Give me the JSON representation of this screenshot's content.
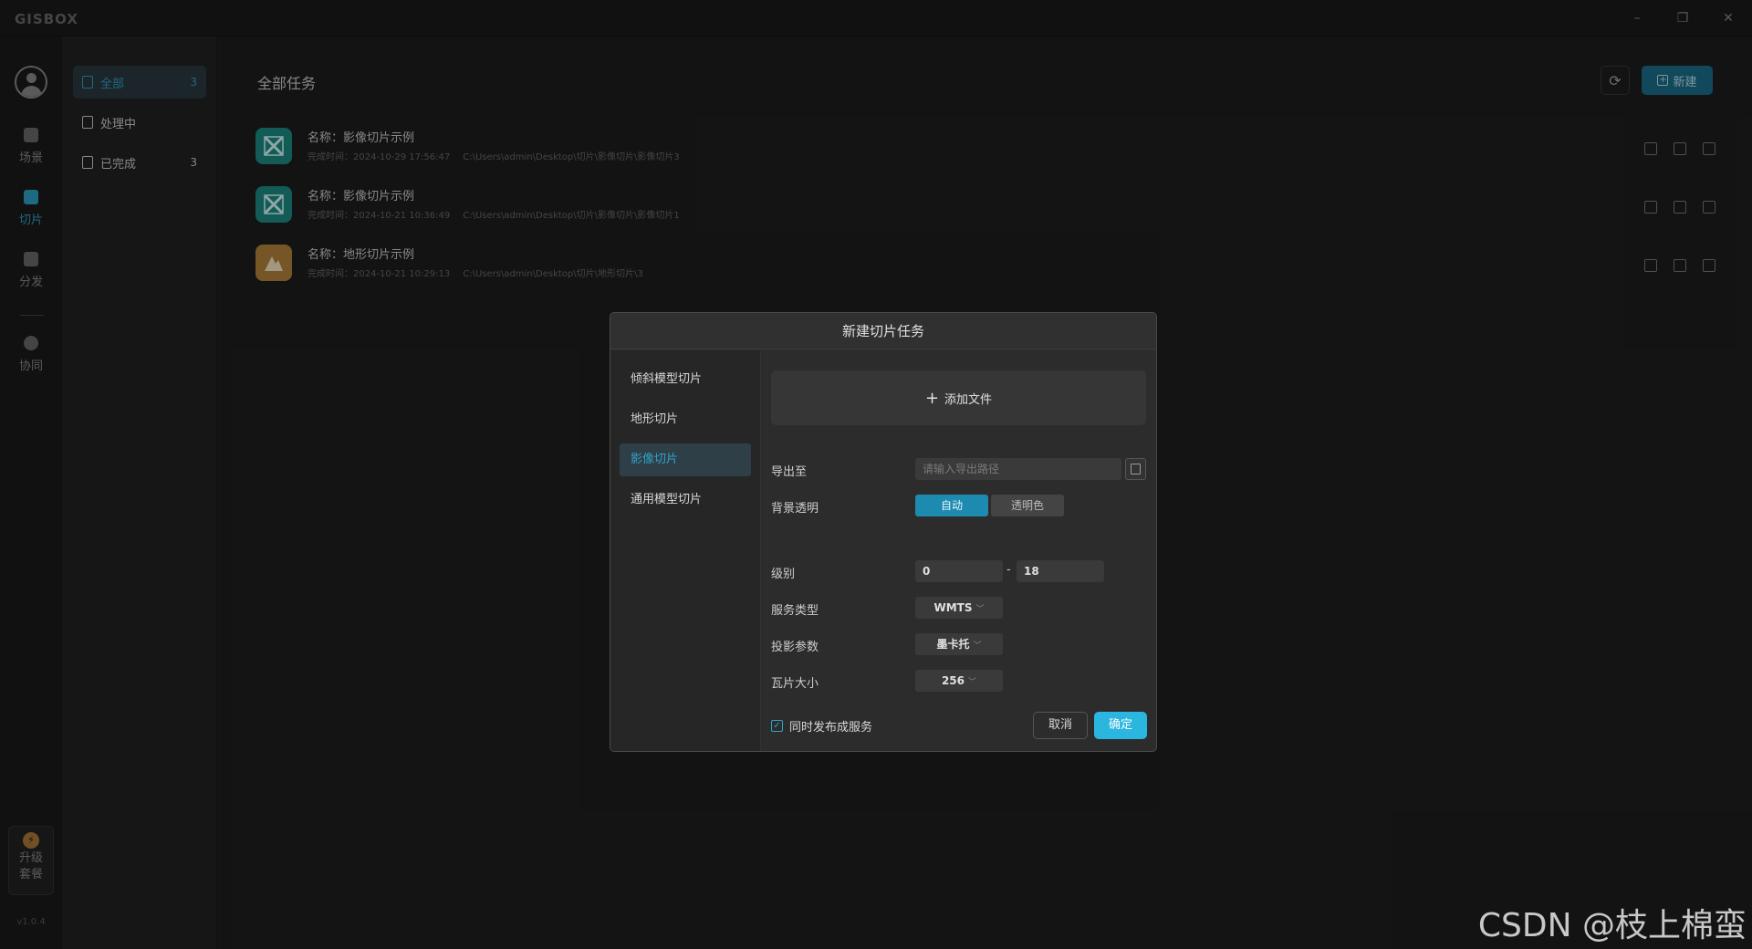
{
  "app": {
    "logo": "GISBOX"
  },
  "window": {
    "minimize": "–",
    "maximize": "❐",
    "close": "✕"
  },
  "rail": {
    "items": [
      {
        "label": "场景"
      },
      {
        "label": "切片"
      },
      {
        "label": "分发"
      },
      {
        "label": "协同"
      }
    ],
    "upgrade": {
      "line1": "升级",
      "line2": "套餐"
    },
    "version": "v1.0.4"
  },
  "subnav": {
    "items": [
      {
        "label": "全部",
        "count": "3"
      },
      {
        "label": "处理中",
        "count": ""
      },
      {
        "label": "已完成",
        "count": "3"
      }
    ]
  },
  "main": {
    "title": "全部任务",
    "new_label": "新建",
    "tasks": [
      {
        "name": "名称：影像切片示例",
        "time": "完成时间：2024-10-29 17:56:47",
        "path": "C:\\Users\\admin\\Desktop\\切片\\影像切片\\影像切片3",
        "type": "image"
      },
      {
        "name": "名称：影像切片示例",
        "time": "完成时间：2024-10-21 10:36:49",
        "path": "C:\\Users\\admin\\Desktop\\切片\\影像切片\\影像切片1",
        "type": "image"
      },
      {
        "name": "名称：地形切片示例",
        "time": "完成时间：2024-10-21 10:29:13",
        "path": "C:\\Users\\admin\\Desktop\\切片\\地形切片\\3",
        "type": "terrain"
      }
    ]
  },
  "dialog": {
    "title": "新建切片任务",
    "tabs": [
      "倾斜模型切片",
      "地形切片",
      "影像切片",
      "通用模型切片"
    ],
    "active_tab": 2,
    "add_file": "添加文件",
    "export_label": "导出至",
    "export_placeholder": "请输入导出路径",
    "bg_label": "背景透明",
    "bg_auto": "自动",
    "bg_color": "透明色",
    "level_label": "级别",
    "level_min": "0",
    "level_max": "18",
    "service_label": "服务类型",
    "service_value": "WMTS",
    "projection_label": "投影参数",
    "projection_value": "墨卡托",
    "tile_label": "瓦片大小",
    "tile_value": "256",
    "publish_label": "同时发布成服务",
    "publish_checked": true,
    "cancel": "取消",
    "ok": "确定"
  },
  "watermark": "CSDN @枝上棉蛮",
  "colors": {
    "accent": "#2fa3c8",
    "ok_button": "#2bb6e0",
    "teal_icon": "#1e8d86",
    "gold_icon": "#b5843d"
  }
}
